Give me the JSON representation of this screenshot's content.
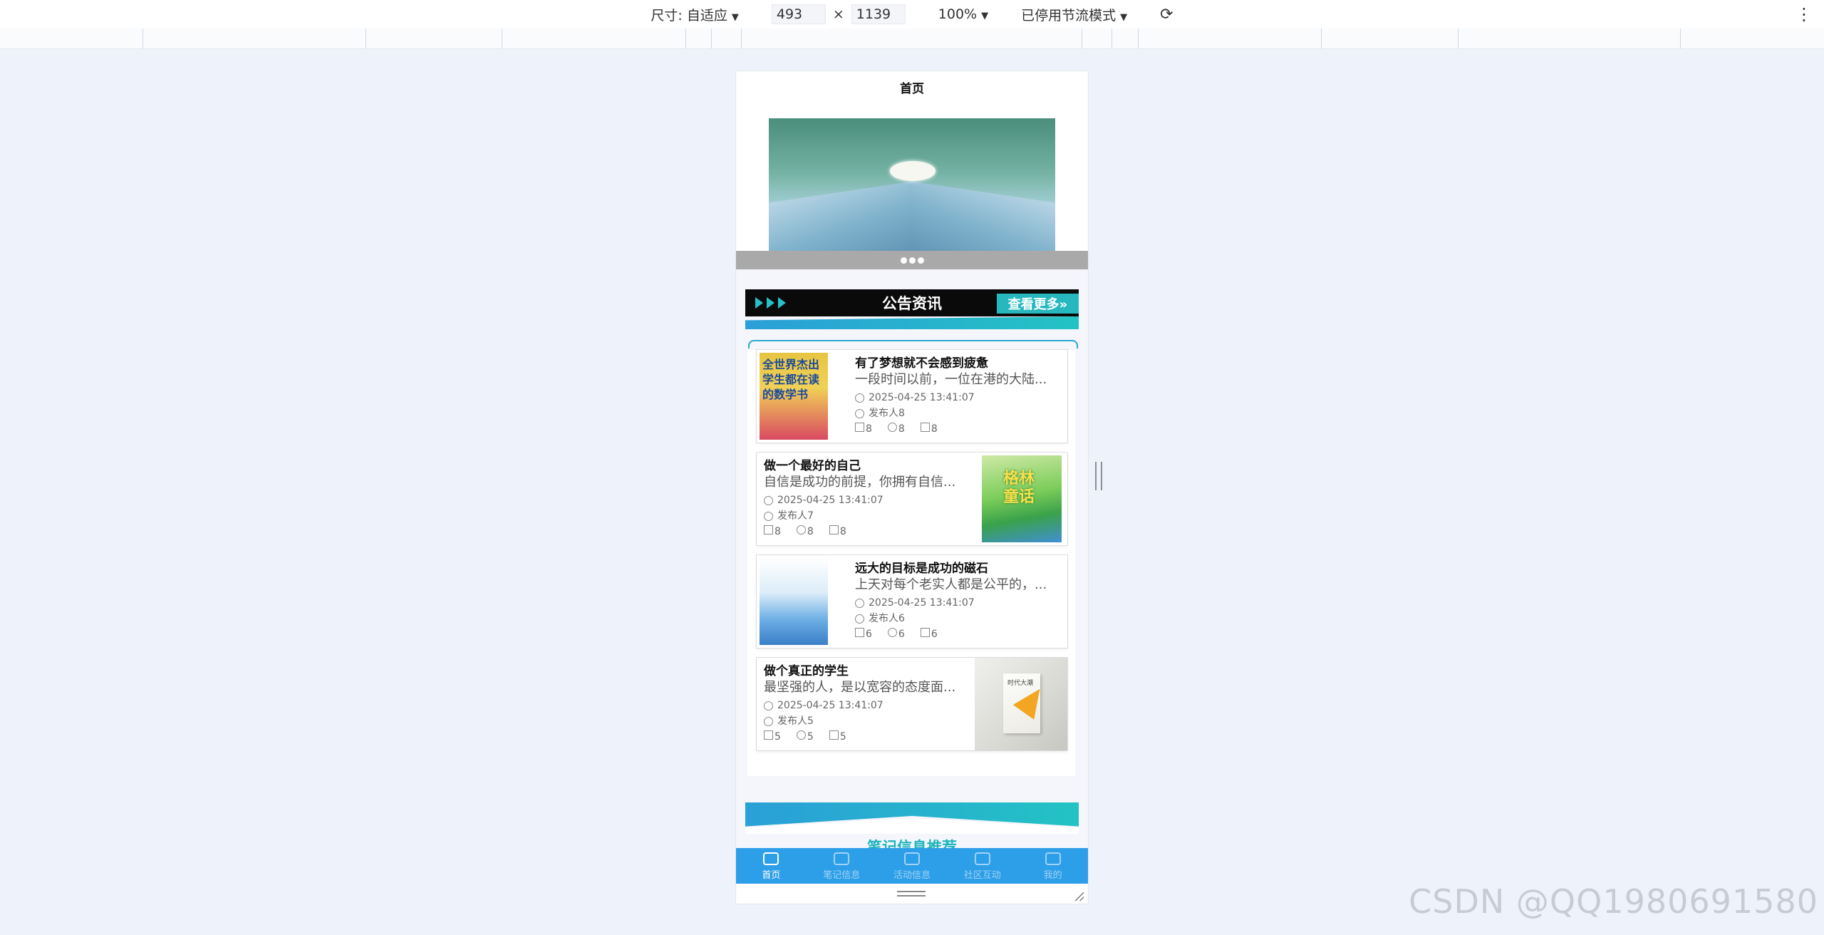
{
  "devtools": {
    "size_label": "尺寸: 自适应",
    "width": "493",
    "times": "×",
    "height": "1139",
    "zoom": "100%",
    "throttle": "已停用节流模式"
  },
  "page": {
    "title": "首页"
  },
  "notice": {
    "title": "公告资讯",
    "more": "查看更多»",
    "items": [
      {
        "title": "有了梦想就不会感到疲惫",
        "desc": "一段时间以前，一位在港的大陆...",
        "time": "2025-04-25 13:41:07",
        "author": "发布人8",
        "likes": "8",
        "favs": "8",
        "views": "8"
      },
      {
        "title": "做一个最好的自己",
        "desc": "自信是成功的前提，你拥有自信...",
        "time": "2025-04-25 13:41:07",
        "author": "发布人7",
        "likes": "8",
        "favs": "8",
        "views": "8"
      },
      {
        "title": "远大的目标是成功的磁石",
        "desc": "上天对每个老实人都是公平的，...",
        "time": "2025-04-25 13:41:07",
        "author": "发布人6",
        "likes": "6",
        "favs": "6",
        "views": "6"
      },
      {
        "title": "做个真正的学生",
        "desc": "最坚强的人，是以宽容的态度面...",
        "time": "2025-04-25 13:41:07",
        "author": "发布人5",
        "likes": "5",
        "favs": "5",
        "views": "5"
      }
    ]
  },
  "cover_text": {
    "book1": "全世界杰出学生都在读的数学书",
    "book2": "格林童话",
    "book3": "",
    "book4": "时代大潮"
  },
  "next_section": "笔记信息推荐",
  "tabs": [
    {
      "label": "首页",
      "icon": "home-icon"
    },
    {
      "label": "笔记信息",
      "icon": "notes-icon"
    },
    {
      "label": "活动信息",
      "icon": "activity-icon"
    },
    {
      "label": "社区互动",
      "icon": "community-icon"
    },
    {
      "label": "我的",
      "icon": "user-icon"
    }
  ],
  "watermark": "CSDN @QQ1980691580",
  "colors": {
    "accent": "#2d9ee8",
    "teal": "#27b8bf"
  }
}
